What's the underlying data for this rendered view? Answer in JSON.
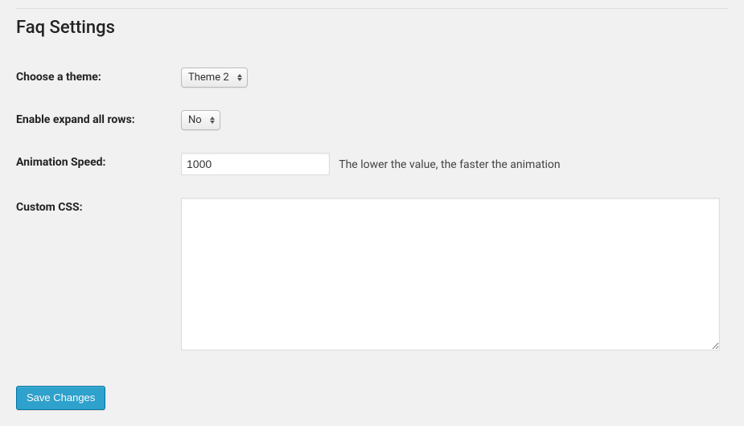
{
  "page": {
    "title": "Faq Settings"
  },
  "fields": {
    "theme": {
      "label": "Choose a theme:",
      "value": "Theme 2"
    },
    "expand_all": {
      "label": "Enable expand all rows:",
      "value": "No"
    },
    "animation_speed": {
      "label": "Animation Speed:",
      "value": "1000",
      "description": "The lower the value, the faster the animation"
    },
    "custom_css": {
      "label": "Custom CSS:",
      "value": ""
    }
  },
  "actions": {
    "save_label": "Save Changes"
  }
}
